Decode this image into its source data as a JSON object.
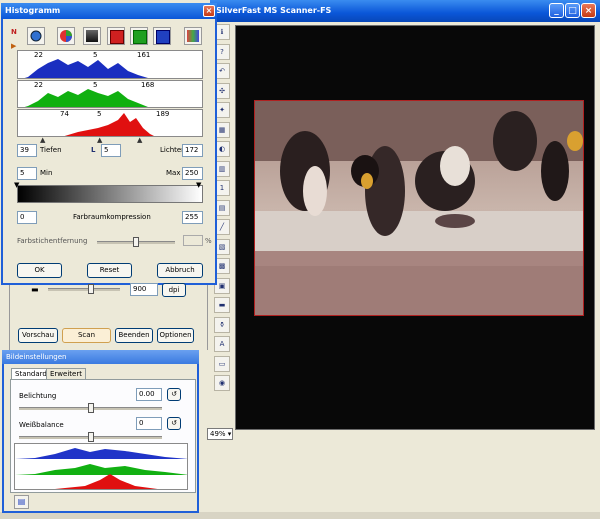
{
  "app": {
    "title": "SilverFast  MS Scanner-FS",
    "zoom": "49%",
    "toolbar_icons": [
      "info-icon",
      "help-icon",
      "undo-icon",
      "select-icon",
      "magic-wand-icon",
      "grid-icon",
      "contrast-icon",
      "gradation-icon",
      "one-icon",
      "histogram-icon",
      "curves-icon",
      "color-icon",
      "sharpen-icon",
      "filter-icon",
      "print-icon",
      "adjust-icon",
      "text-icon",
      "film-icon",
      "settings-icon"
    ],
    "toolbar_glyphs": [
      "ℹ",
      "?",
      "↶",
      "✣",
      "✦",
      "▦",
      "◐",
      "▥",
      "1",
      "▤",
      "╱",
      "▧",
      "▩",
      "▣",
      "▬",
      "⚱",
      "A",
      "▭",
      "◉"
    ]
  },
  "histogram": {
    "title": "Histogramm",
    "close": "×",
    "blue_values": [
      "22",
      "5",
      "161"
    ],
    "green_values": [
      "22",
      "5",
      "168"
    ],
    "red_values": [
      "74",
      "5",
      "189"
    ],
    "tiefen_value": "39",
    "tiefen_label": "Tiefen",
    "l_label": "L",
    "l_value": "5",
    "lichter_label": "Lichter",
    "lichter_value": "172",
    "min_value": "5",
    "min_label": "Min",
    "max_label": "Max",
    "max_value": "250",
    "farbraum_left": "0",
    "farbraum_label": "Farbraumkompression",
    "farbraum_right": "255",
    "farbstich_label": "Farbstichentfernung",
    "farbstich_unit": "%",
    "ok": "OK",
    "reset": "Reset",
    "abbruch": "Abbruch"
  },
  "scanpanel": {
    "dpi_value": "900",
    "dpi_unit": "dpi",
    "vorschau": "Vorschau",
    "scan": "Scan",
    "beenden": "Beenden",
    "optionen": "Optionen"
  },
  "bild": {
    "title": "Bildeinstellungen",
    "tab_standard": "Standard",
    "tab_erweitert": "Erweitert",
    "belichtung_label": "Belichtung",
    "belichtung_value": "0.00",
    "weiss_label": "Weißbalance",
    "weiss_value": "0"
  },
  "colors": {
    "titlebar": "#0a56d8",
    "preview_bg": "#080808"
  }
}
